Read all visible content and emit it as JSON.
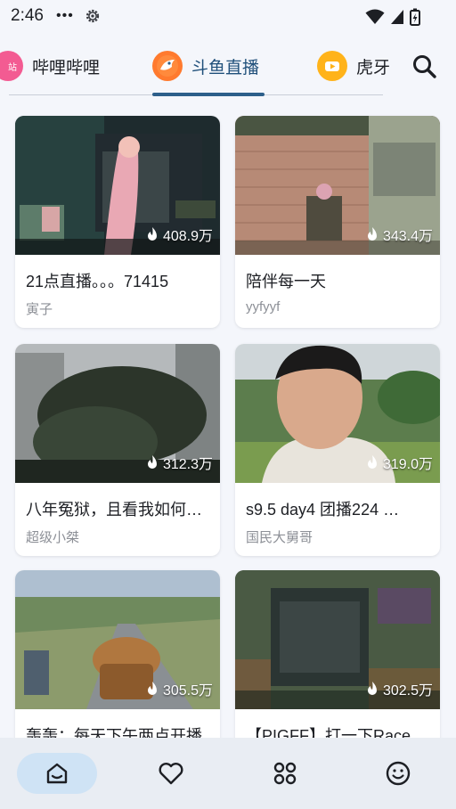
{
  "status_bar": {
    "time": "2:46",
    "dots": "•••"
  },
  "tabs": [
    {
      "label": "哔哩哔哩",
      "icon": "bilibili-logo-icon",
      "active": false
    },
    {
      "label": "斗鱼直播",
      "icon": "douyu-logo-icon",
      "active": true
    },
    {
      "label": "虎牙",
      "icon": "huya-logo-icon",
      "active": false
    }
  ],
  "search": {
    "icon": "search-icon"
  },
  "cards": [
    {
      "title": "21点直播。。。71415",
      "streamer": "寅子",
      "viewers": "408.9万"
    },
    {
      "title": "陪伴每一天",
      "streamer": "yyfyyf",
      "viewers": "343.4万"
    },
    {
      "title": "八年冤狱，且看我如何翻案",
      "streamer": "超级小桀",
      "viewers": "312.3万"
    },
    {
      "title": "s9.5 day4 团播224 …",
      "streamer": "国民大舅哥",
      "viewers": "319.0万"
    },
    {
      "title": "轰轰：每天下午两点开播",
      "streamer": "",
      "viewers": "305.5万"
    },
    {
      "title": "【PIGFF】打一下Race",
      "streamer": "",
      "viewers": "302.5万"
    }
  ],
  "bottom_nav": [
    {
      "name": "home",
      "icon": "home-icon",
      "active": true
    },
    {
      "name": "favorites",
      "icon": "heart-icon",
      "active": false
    },
    {
      "name": "categories",
      "icon": "grid-icon",
      "active": false
    },
    {
      "name": "profile",
      "icon": "smiley-icon",
      "active": false
    }
  ],
  "colors": {
    "accent": "#2d5f8a",
    "active_tab_text": "#1f4f7a",
    "background": "#f4f6fb",
    "nav_active": "#cfe3f5",
    "secondary_text": "#8d9097"
  }
}
